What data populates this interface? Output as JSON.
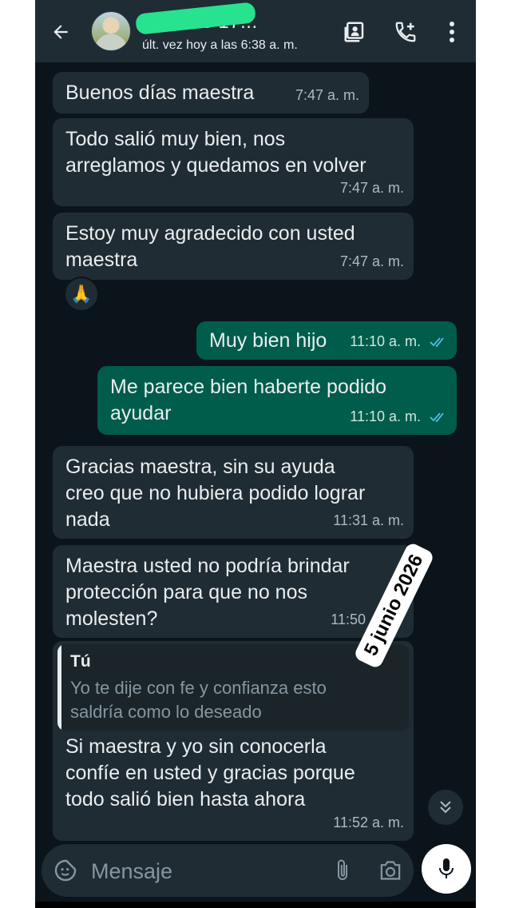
{
  "header": {
    "contact_name": "96 1228 17...",
    "last_seen": "últ. vez hoy a las 6:38 a. m."
  },
  "messages": [
    {
      "dir": "in",
      "text": "Buenos días maestra",
      "time": "7:47 a. m."
    },
    {
      "dir": "in",
      "text": "Todo salió muy bien, nos\narreglamos y quedamos en volver",
      "time": "7:47 a. m."
    },
    {
      "dir": "in",
      "text": "Estoy muy agradecido con usted\nmaestra",
      "time": "7:47 a. m.",
      "reaction": "🙏"
    },
    {
      "dir": "out",
      "text": "Muy bien hijo",
      "time": "11:10 a. m."
    },
    {
      "dir": "out",
      "text": "Me parece bien haberte podido\nayudar",
      "time": "11:10 a. m."
    },
    {
      "dir": "in",
      "text": "Gracias maestra, sin su ayuda\ncreo que no hubiera podido lograr\nnada",
      "time": "11:31 a. m."
    },
    {
      "dir": "in",
      "text": "Maestra usted no podría brindar\nprotección para que no nos\nmolesten?",
      "time": "11:50"
    },
    {
      "dir": "in",
      "text": "Si maestra y yo sin conocerla\nconfíe en usted y gracias porque\ntodo salió bien hasta ahora",
      "time": "11:52 a. m."
    }
  ],
  "quote": {
    "author": "Tú",
    "text": "Yo te dije con fe y confianza esto\nsaldría como lo deseado"
  },
  "date_sticker": "5 junio 2026",
  "composer": {
    "placeholder": "Mensaje"
  },
  "colors": {
    "background": "#0b141a",
    "incoming_bubble": "#202c33",
    "outgoing_bubble": "#005c4b",
    "header": "#1f2c34",
    "read_ticks": "#53bdeb"
  }
}
